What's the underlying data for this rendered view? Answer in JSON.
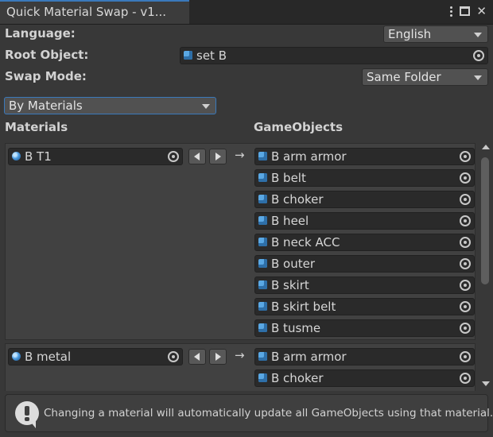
{
  "window": {
    "tab_title": "Quick Material Swap - v1...",
    "icons": [
      "kebab-menu-icon",
      "maximize-icon",
      "close-icon"
    ]
  },
  "fields": {
    "language_label": "Language:",
    "language_value": "English",
    "root_label": "Root Object:",
    "root_value": "set B",
    "swap_label": "Swap Mode:",
    "swap_value": "Same Folder"
  },
  "mode": {
    "value": "By Materials"
  },
  "columns": {
    "materials": "Materials",
    "gameobjects": "GameObjects"
  },
  "groups": [
    {
      "material": "B T1",
      "objects": [
        "B arm armor",
        "B belt",
        "B choker",
        "B heel",
        "B neck ACC",
        "B outer",
        "B skirt",
        "B skirt belt",
        "B tusme"
      ]
    },
    {
      "material": "B metal",
      "objects": [
        "B arm armor",
        "B choker"
      ]
    }
  ],
  "help": {
    "text": "Changing a material will automatically update all GameObjects using that material."
  },
  "colors": {
    "background": "#383838",
    "field": "#2a2a2a",
    "accent": "#3a79bb",
    "icon_blue": "#5aa8e4"
  }
}
